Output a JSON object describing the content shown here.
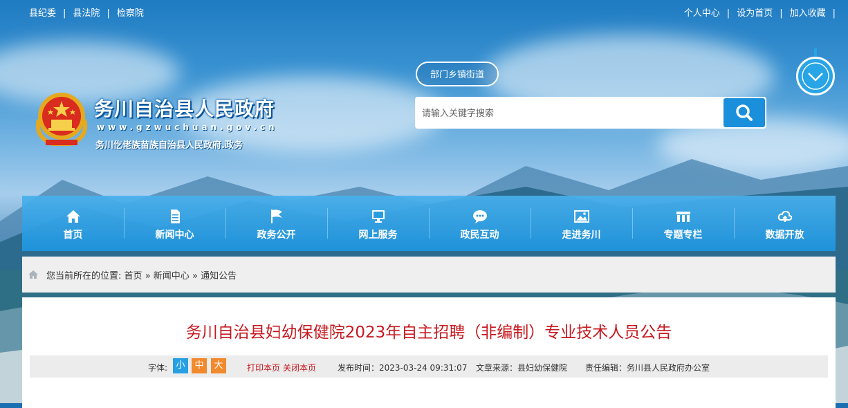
{
  "top_left_links": [
    "县纪委",
    "县法院",
    "检察院"
  ],
  "top_right_links": [
    "个人中心",
    "设为首页",
    "加入收藏"
  ],
  "site": {
    "title": "务川自治县人民政府",
    "url": "www.gzwuchuan.gov.cn",
    "subtitle": "务川仡佬族苗族自治县人民政府.政务"
  },
  "search": {
    "dept_button": "部门乡镇街道",
    "placeholder": "请输入关键字搜索"
  },
  "nav": [
    {
      "label": "首页",
      "icon": "home-icon"
    },
    {
      "label": "新闻中心",
      "icon": "document-icon"
    },
    {
      "label": "政务公开",
      "icon": "flag-icon"
    },
    {
      "label": "网上服务",
      "icon": "monitor-icon"
    },
    {
      "label": "政民互动",
      "icon": "chat-icon"
    },
    {
      "label": "走进务川",
      "icon": "picture-icon"
    },
    {
      "label": "专题专栏",
      "icon": "columns-icon"
    },
    {
      "label": "数据开放",
      "icon": "cloud-icon"
    }
  ],
  "breadcrumb": {
    "prefix": "您当前所在的位置:",
    "items": [
      "首页",
      "新闻中心",
      "通知公告"
    ],
    "separator": "»"
  },
  "article": {
    "title": "务川自治县妇幼保健院2023年自主招聘（非编制）专业技术人员公告",
    "font_label": "字体:",
    "font_small": "小",
    "font_medium": "中",
    "font_large": "大",
    "print": "打印本页",
    "close": "关闭本页",
    "publish_time": "发布时间：2023-03-24 09:31:07",
    "source": "文章来源：县妇幼保健院",
    "editor": "责任编辑：务川县人民政府办公室"
  },
  "colors": {
    "accent": "#1a8fdc",
    "title_red": "#c7181f",
    "font_small_bg": "#26a0e2",
    "font_medium_bg": "#f08a2c",
    "font_large_bg": "#f08a2c"
  }
}
